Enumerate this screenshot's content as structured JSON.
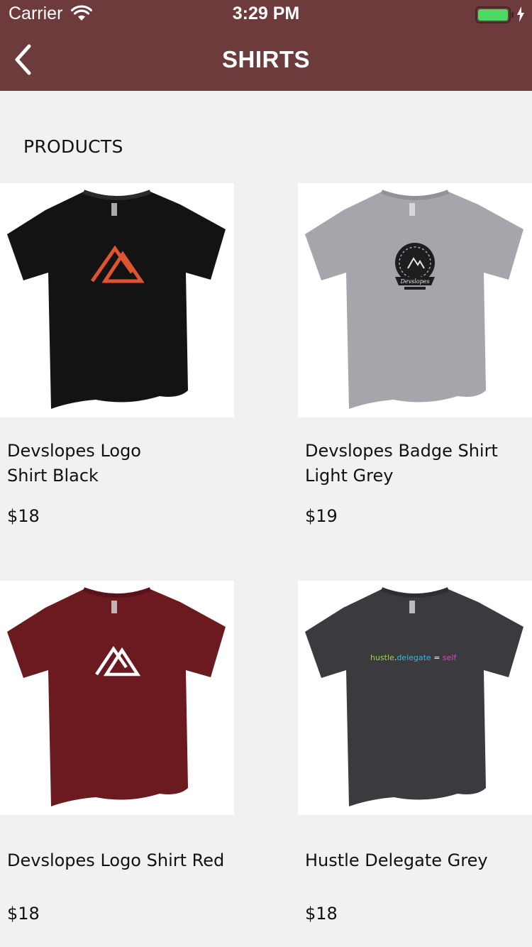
{
  "status_bar": {
    "carrier": "Carrier",
    "time": "3:29 PM",
    "icons": [
      "wifi-icon",
      "battery-icon",
      "charging-bolt-icon"
    ],
    "battery_color": "#4cd964"
  },
  "nav_bar": {
    "title": "SHIRTS",
    "back_icon": "chevron-left-icon",
    "background_color": "#6e3b3c"
  },
  "section": {
    "title": "PRODUCTS"
  },
  "products": [
    {
      "title_line1": "Devslopes Logo",
      "title_line2": "Shirt Black",
      "price": "$18",
      "shirt_color": "#131313",
      "graphic": "mountain-logo"
    },
    {
      "title_line1": "Devslopes Badge Shirt",
      "title_line2": "Light Grey",
      "price": "$19",
      "shirt_color": "#a6a5ab",
      "graphic": "devslopes-badge"
    },
    {
      "title_line1": "Devslopes Logo Shirt Red",
      "title_line2": "",
      "price": "$18",
      "shirt_color": "#6b1a1f",
      "graphic": "mountain-logo"
    },
    {
      "title_line1": "Hustle Delegate Grey",
      "title_line2": "",
      "price": "$18",
      "shirt_color": "#3b3b3f",
      "graphic": "code-text"
    }
  ],
  "graphics": {
    "code_text": {
      "part1": "hustle",
      "part2": ".",
      "part3": "delegate",
      "part4": " = ",
      "part5": "self"
    },
    "badge_text": "Devslopes"
  }
}
